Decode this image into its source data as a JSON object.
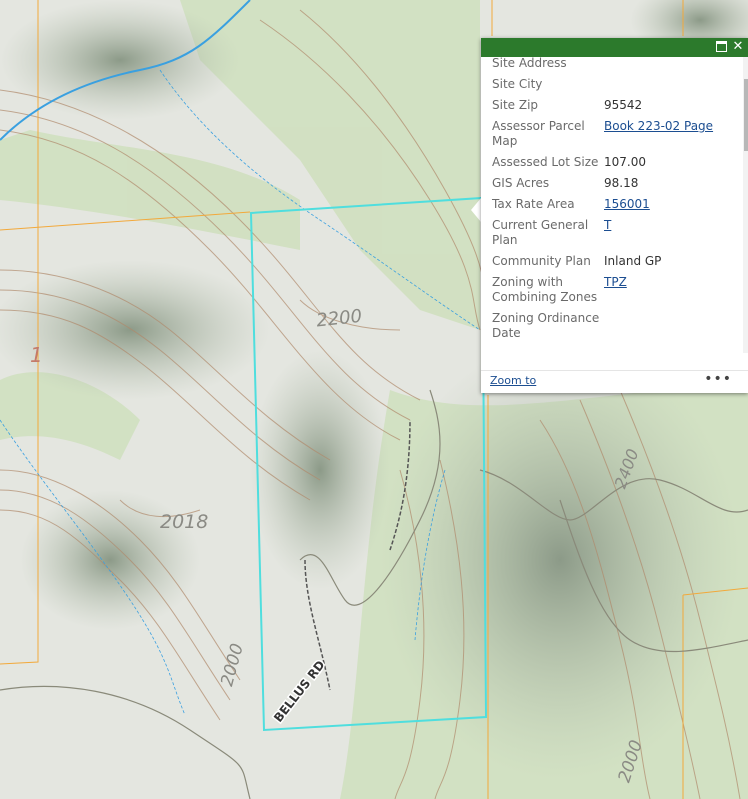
{
  "map": {
    "contour_labels": [
      "2200",
      "2018",
      "2000",
      "2000",
      "1",
      "2400"
    ],
    "road_label": "BELLUS RD",
    "colors": {
      "parcel_outline": "#4fdede",
      "boundary_line": "#f2a93b",
      "stream": "#3aa0e0",
      "contour": "#b08a6c",
      "vegetation": "#c8dcb4"
    }
  },
  "popup": {
    "header_color": "#2c7a2c",
    "maximize_icon": "maximize-icon",
    "close_icon": "close-icon",
    "close_label": "✕",
    "fields": [
      {
        "label": "Site Address",
        "value": ""
      },
      {
        "label": "Site City",
        "value": ""
      },
      {
        "label": "Site Zip",
        "value": "95542"
      },
      {
        "label": "Assessor Parcel Map",
        "value": "Book 223-02 Page",
        "link": true
      },
      {
        "label": "Assessed Lot Size",
        "value": "107.00"
      },
      {
        "label": "GIS Acres",
        "value": "98.18"
      },
      {
        "label": "Tax Rate Area",
        "value": "156001",
        "link": true
      },
      {
        "label": "Current General Plan",
        "value": "T",
        "link": true
      },
      {
        "label": "Community Plan",
        "value": "Inland GP"
      },
      {
        "label": "Zoning with Combining Zones",
        "value": "TPZ",
        "link": true
      },
      {
        "label": "Zoning Ordinance Date",
        "value": ""
      }
    ],
    "zoom_label": "Zoom to",
    "more_label": "•••"
  }
}
